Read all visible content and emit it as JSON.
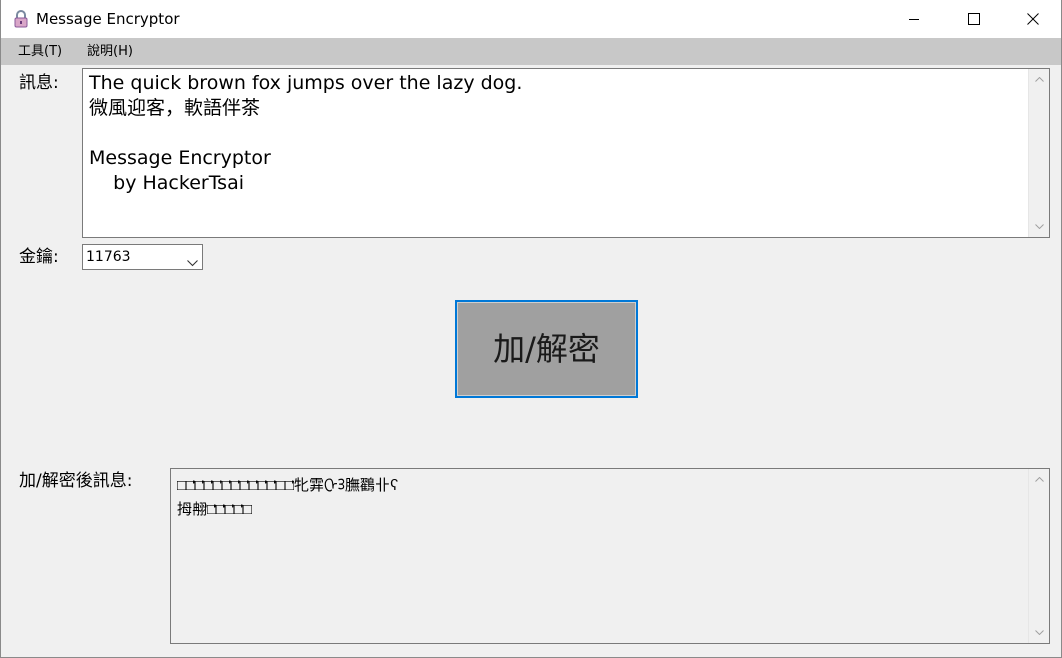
{
  "window": {
    "title": "Message Encryptor",
    "icon": "lock-icon"
  },
  "menubar": {
    "tools": "工具(T)",
    "help": "說明(H)"
  },
  "form": {
    "message_label": "訊息:",
    "message_value": "The quick brown fox jumps over the lazy dog.\n微風迎客，軟語伴茶\n\nMessage Encryptor\n    by HackerTsai",
    "key_label": "金鑰:",
    "key_value": "11763",
    "encrypt_button": "加/解密",
    "result_label": "加/解密後訊息:",
    "result_value": "□□ᡃᡃᡃᡃᡃᡃᡃᡃ□ᡃᡃᡃ□ᡃᡃᡃᡃ□ᡃᡃ□ᡃᡃᡃ□ᡃᡃᡃ□ᡃᡃᡃ□ᡃᡃᡃᡃ□ᡃᡃᡃᡃᡃᡃ□ᡃᡃᡃᡃᡃᡃ□□ᡃᡃᡃ牝䨍ᢕᢃ膴鸐卝ʕ\n拇䎃ᡃᡃᡃᡃᡃᡃᡃᡃᡃᡃᡃᡃ□ᡃᡃᡃᡃᡃᡃᡃ□ᡃᡃᡃᡃᡃᡃᡃᡃᡃᡃᡃᡃ□ᡃᡃᡃ□ᡃᡃᡃ□"
  },
  "colors": {
    "menubar_bg": "#c8c8c8",
    "button_bg": "#a0a0a0",
    "button_focus_border": "#0078d7"
  }
}
